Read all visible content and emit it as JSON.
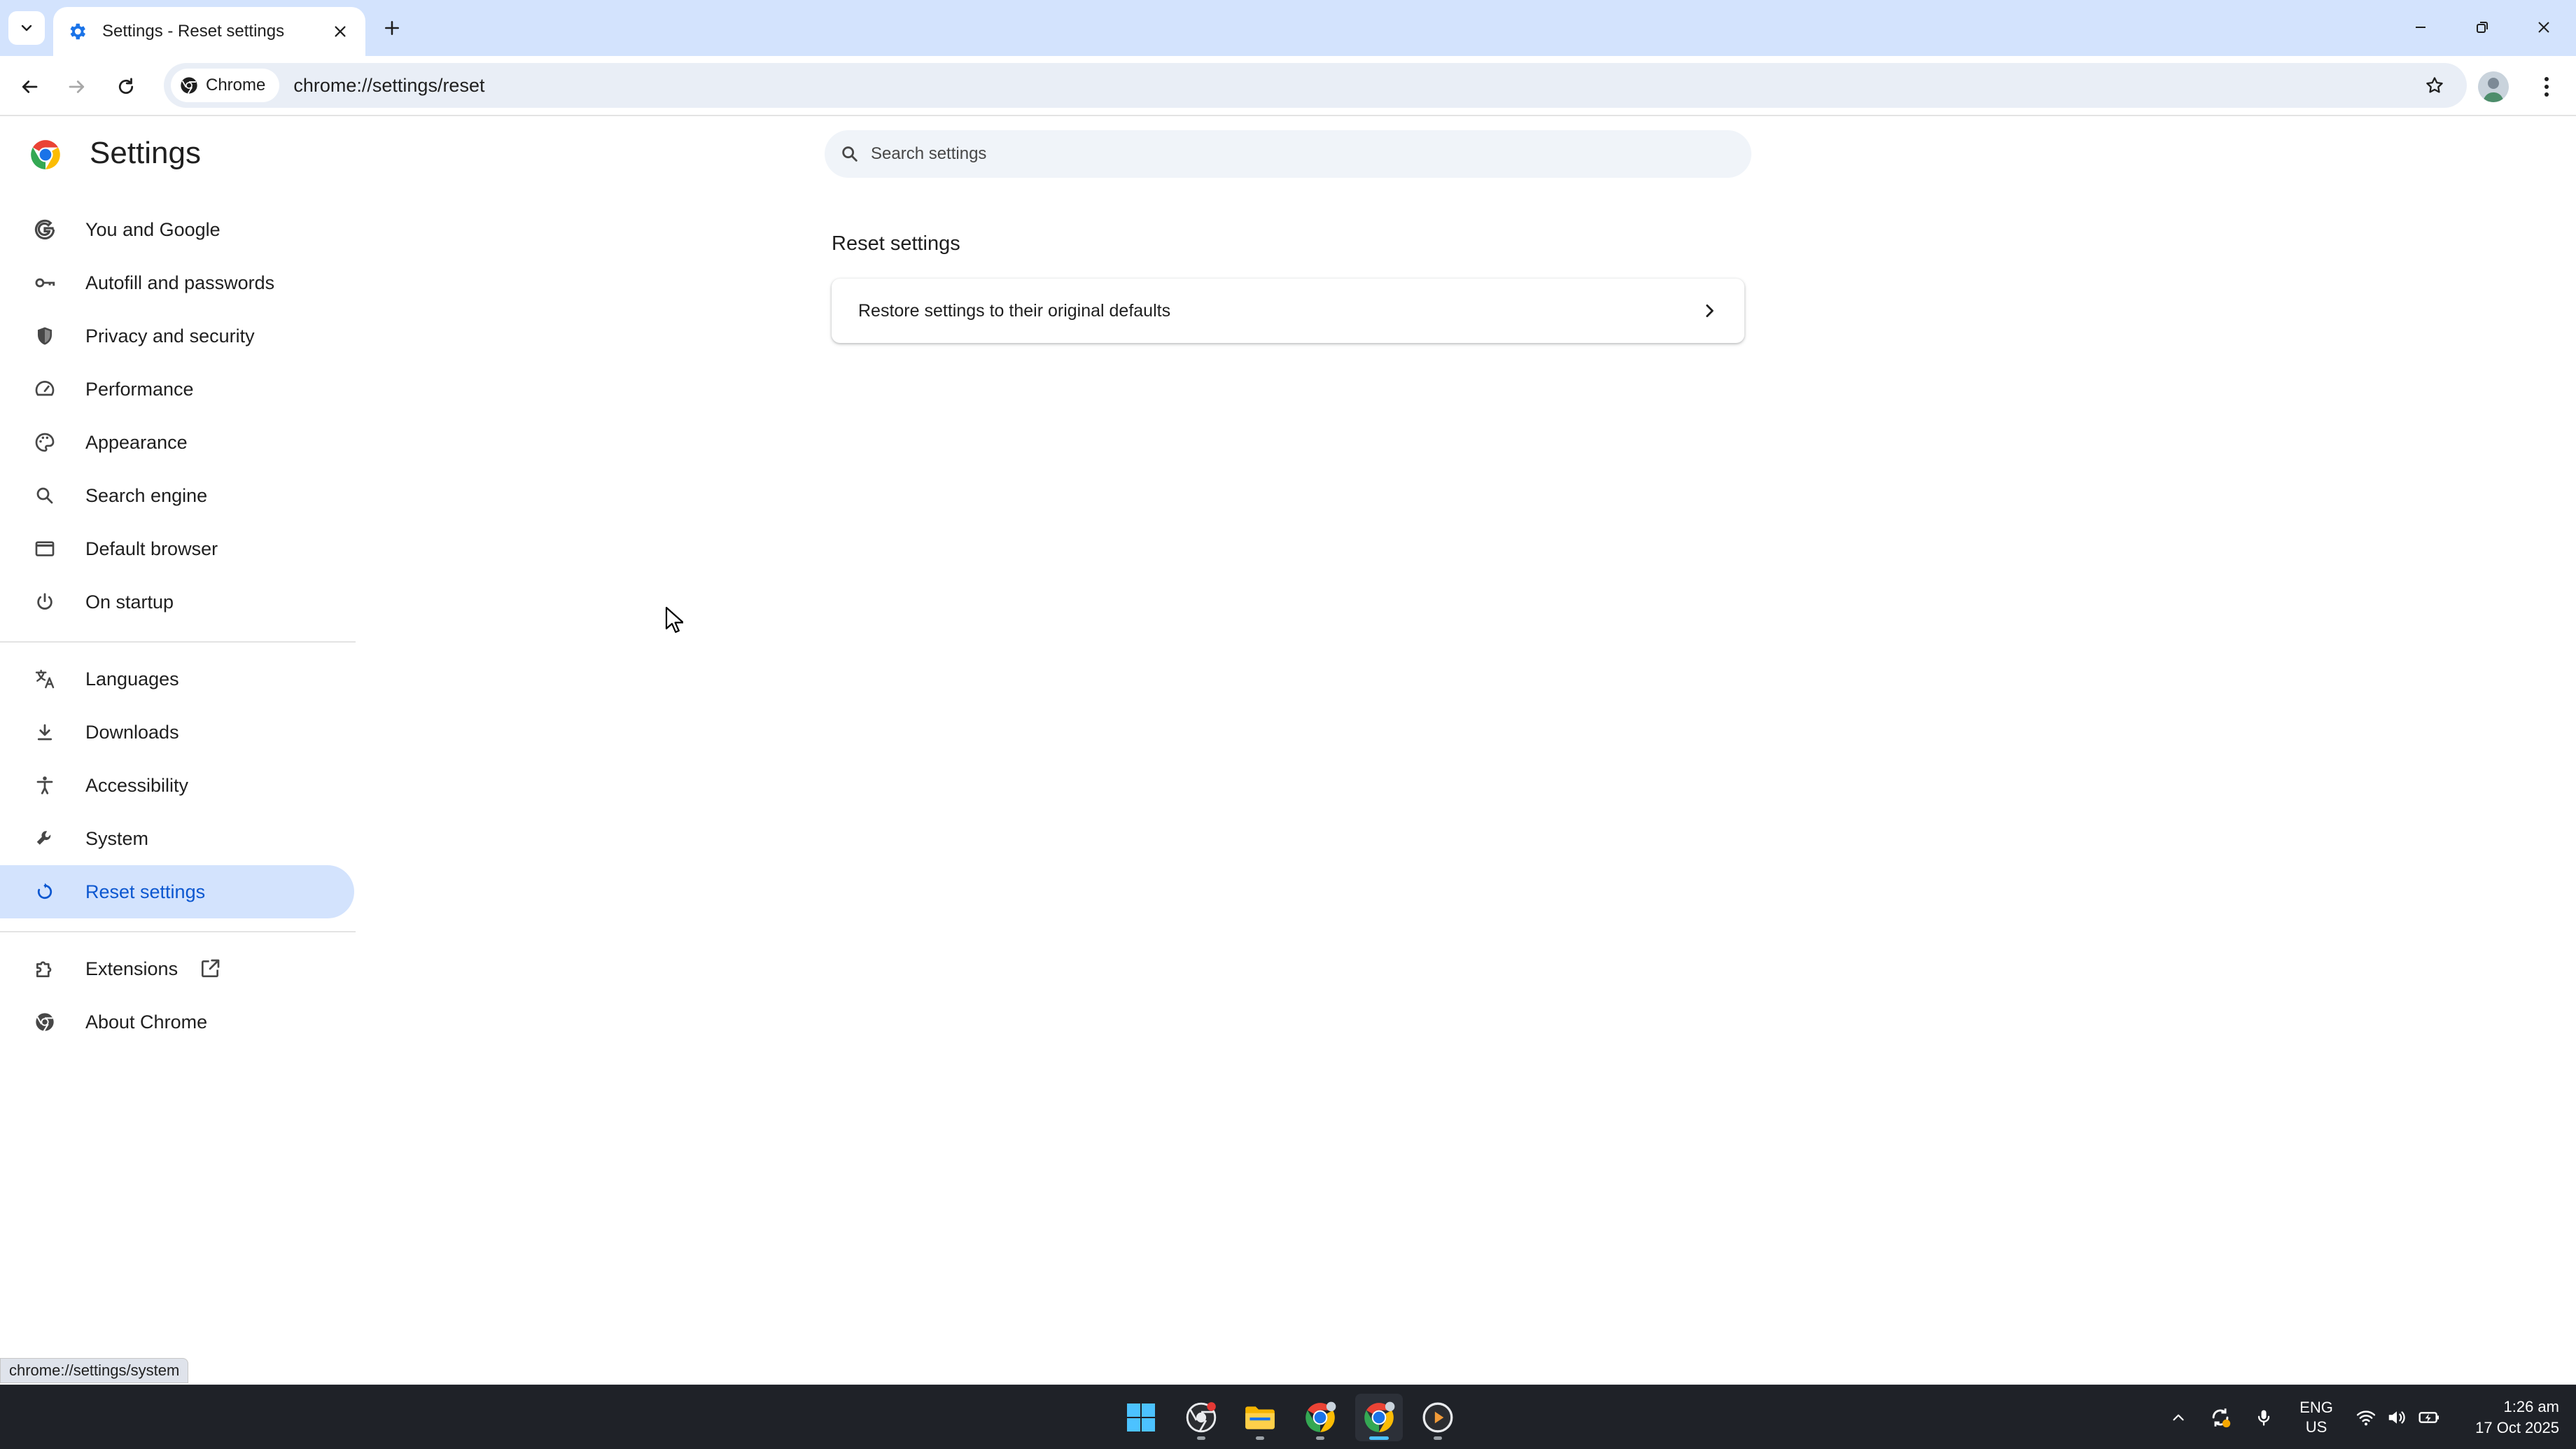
{
  "browser": {
    "tab_title": "Settings - Reset settings",
    "chip_label": "Chrome",
    "url": "chrome://settings/reset"
  },
  "settings": {
    "title": "Settings",
    "search_placeholder": "Search settings"
  },
  "sidebar": {
    "items": [
      {
        "label": "You and Google",
        "icon": "google-icon"
      },
      {
        "label": "Autofill and passwords",
        "icon": "key-icon"
      },
      {
        "label": "Privacy and security",
        "icon": "shield-icon"
      },
      {
        "label": "Performance",
        "icon": "speedometer-icon"
      },
      {
        "label": "Appearance",
        "icon": "palette-icon"
      },
      {
        "label": "Search engine",
        "icon": "search-icon"
      },
      {
        "label": "Default browser",
        "icon": "browser-window-icon"
      },
      {
        "label": "On startup",
        "icon": "power-icon"
      },
      {
        "label": "Languages",
        "icon": "translate-icon"
      },
      {
        "label": "Downloads",
        "icon": "download-icon"
      },
      {
        "label": "Accessibility",
        "icon": "accessibility-icon"
      },
      {
        "label": "System",
        "icon": "wrench-icon"
      },
      {
        "label": "Reset settings",
        "icon": "reset-icon",
        "active": true
      },
      {
        "label": "Extensions",
        "icon": "puzzle-icon"
      },
      {
        "label": "About Chrome",
        "icon": "chrome-icon"
      }
    ]
  },
  "main": {
    "section_title": "Reset settings",
    "restore_label": "Restore settings to their original defaults"
  },
  "status_bubble": "chrome://settings/system",
  "taskbar": {
    "lang_top": "ENG",
    "lang_bottom": "US",
    "time": "1:26 am",
    "date": "17 Oct 2025"
  },
  "colors": {
    "accent": "#0b57d0",
    "active_nav_bg": "#d3e3fd",
    "titlebar_bg": "#d3e3fd",
    "taskbar_bg": "#1f2228"
  }
}
